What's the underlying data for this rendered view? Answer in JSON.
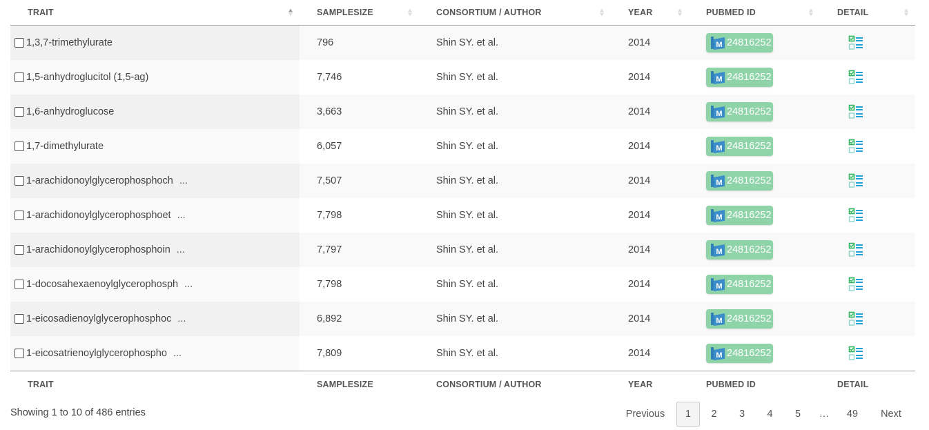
{
  "columns": {
    "trait": "TRAIT",
    "samplesize": "SAMPLESIZE",
    "author": "CONSORTIUM / AUTHOR",
    "year": "YEAR",
    "pubmed": "PUBMED ID",
    "detail": "DETAIL"
  },
  "rows": [
    {
      "trait": "1,3,7-trimethylurate",
      "ellipsis": "",
      "samplesize": "796",
      "author": "Shin SY. et al.",
      "year": "2014",
      "pubmed": "24816252"
    },
    {
      "trait": "1,5-anhydroglucitol (1,5-ag)",
      "ellipsis": "",
      "samplesize": "7,746",
      "author": "Shin SY. et al.",
      "year": "2014",
      "pubmed": "24816252"
    },
    {
      "trait": "1,6-anhydroglucose",
      "ellipsis": "",
      "samplesize": "3,663",
      "author": "Shin SY. et al.",
      "year": "2014",
      "pubmed": "24816252"
    },
    {
      "trait": "1,7-dimethylurate",
      "ellipsis": "",
      "samplesize": "6,057",
      "author": "Shin SY. et al.",
      "year": "2014",
      "pubmed": "24816252"
    },
    {
      "trait": "1-arachidonoylglycerophosphoch",
      "ellipsis": "...",
      "samplesize": "7,507",
      "author": "Shin SY. et al.",
      "year": "2014",
      "pubmed": "24816252"
    },
    {
      "trait": "1-arachidonoylglycerophosphoet",
      "ellipsis": "...",
      "samplesize": "7,798",
      "author": "Shin SY. et al.",
      "year": "2014",
      "pubmed": "24816252"
    },
    {
      "trait": "1-arachidonoylglycerophosphoin",
      "ellipsis": "...",
      "samplesize": "7,797",
      "author": "Shin SY. et al.",
      "year": "2014",
      "pubmed": "24816252"
    },
    {
      "trait": "1-docosahexaenoylglycerophosph",
      "ellipsis": "...",
      "samplesize": "7,798",
      "author": "Shin SY. et al.",
      "year": "2014",
      "pubmed": "24816252"
    },
    {
      "trait": "1-eicosadienoylglycerophosphoc",
      "ellipsis": "...",
      "samplesize": "6,892",
      "author": "Shin SY. et al.",
      "year": "2014",
      "pubmed": "24816252"
    },
    {
      "trait": "1-eicosatrienoylglycerophospho",
      "ellipsis": "...",
      "samplesize": "7,809",
      "author": "Shin SY. et al.",
      "year": "2014",
      "pubmed": "24816252"
    }
  ],
  "info": "Showing 1 to 10 of 486 entries",
  "pagination": {
    "previous": "Previous",
    "pages": [
      "1",
      "2",
      "3",
      "4",
      "5",
      "…",
      "49"
    ],
    "current": "1",
    "next": "Next"
  },
  "colors": {
    "pubmed_badge": "#8fd4a8",
    "detail_icon": "#2bb5a0"
  },
  "icons": {
    "pubmed": "pubmed-logo-icon",
    "detail": "detail-list-icon"
  }
}
